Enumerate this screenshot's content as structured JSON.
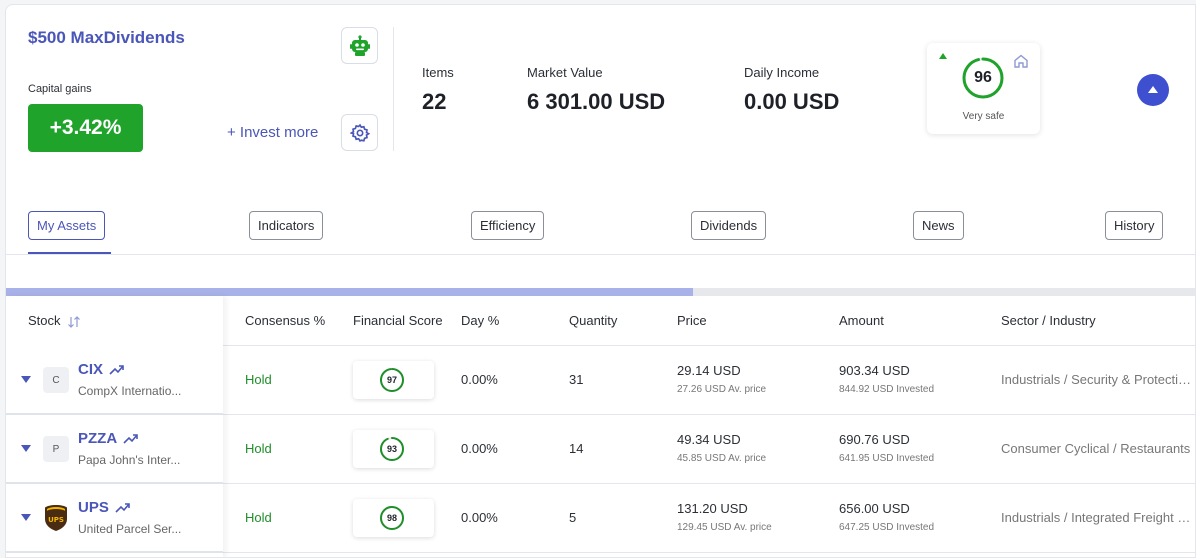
{
  "header": {
    "portfolio_name": "$500 MaxDividends",
    "capital_gains_label": "Capital gains",
    "capital_gains_value": "+3.42%",
    "invest_more": "+ Invest more",
    "stats": [
      {
        "label": "Items",
        "value": "22"
      },
      {
        "label": "Market Value",
        "value": "6 301.00 USD"
      },
      {
        "label": "Daily Income",
        "value": "0.00 USD"
      }
    ],
    "safety": {
      "score": "96",
      "label": "Very safe",
      "fraction": 0.96,
      "color": "#1fa32b"
    }
  },
  "tabs": [
    {
      "label": "My Assets",
      "active": true
    },
    {
      "label": "Indicators",
      "active": false
    },
    {
      "label": "Efficiency",
      "active": false
    },
    {
      "label": "Dividends",
      "active": false
    },
    {
      "label": "News",
      "active": false
    },
    {
      "label": "History",
      "active": false
    }
  ],
  "table": {
    "columns": [
      "Stock",
      "Consensus %",
      "Financial Score",
      "Day %",
      "Quantity",
      "Price",
      "Amount",
      "Sector / Industry"
    ],
    "rows": [
      {
        "logo": "C",
        "ticker": "CIX",
        "company": "CompX Internatio...",
        "consensus": "Hold",
        "score": "97",
        "score_fraction": 0.97,
        "day": "0.00%",
        "quantity": "31",
        "price": "29.14 USD",
        "avg_price": "27.26 USD Av. price",
        "amount": "903.34 USD",
        "invested": "844.92 USD Invested",
        "sector": "Industrials / Security & Protection Services"
      },
      {
        "logo": "P",
        "ticker": "PZZA",
        "company": "Papa John's Inter...",
        "consensus": "Hold",
        "score": "93",
        "score_fraction": 0.93,
        "day": "0.00%",
        "quantity": "14",
        "price": "49.34 USD",
        "avg_price": "45.85 USD Av. price",
        "amount": "690.76 USD",
        "invested": "641.95 USD Invested",
        "sector": "Consumer Cyclical / Restaurants"
      },
      {
        "logo": "UPS",
        "ticker": "UPS",
        "company": "United Parcel Ser...",
        "consensus": "Hold",
        "score": "98",
        "score_fraction": 0.98,
        "day": "0.00%",
        "quantity": "5",
        "price": "131.20 USD",
        "avg_price": "129.45 USD Av. price",
        "amount": "656.00 USD",
        "invested": "647.25 USD Invested",
        "sector": "Industrials / Integrated Freight & Logistics"
      }
    ]
  },
  "colors": {
    "accent": "#4a56b8",
    "positive": "#1fa32b",
    "hold": "#1f8f2a"
  },
  "icons": {
    "bot": "robot-icon",
    "settings": "gear-icon",
    "home": "home-icon",
    "collapse": "chevron-up-icon",
    "trend": "trend-up-icon",
    "sort": "sort-icon"
  }
}
